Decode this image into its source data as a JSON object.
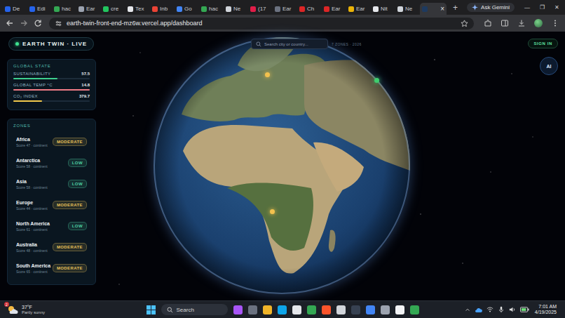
{
  "browser": {
    "tabs": [
      {
        "label": "De",
        "selected": false,
        "color": "#2563eb"
      },
      {
        "label": "Edi",
        "selected": false,
        "color": "#2563eb"
      },
      {
        "label": "hac",
        "selected": false,
        "color": "#34a853"
      },
      {
        "label": "Ear",
        "selected": false,
        "color": "#9ca3af"
      },
      {
        "label": "cre",
        "selected": false,
        "color": "#22c55e"
      },
      {
        "label": "Tex",
        "selected": false,
        "color": "#e5e7eb"
      },
      {
        "label": "Inb",
        "selected": false,
        "color": "#ea4335"
      },
      {
        "label": "Go",
        "selected": false,
        "color": "#4285f4"
      },
      {
        "label": "hac",
        "selected": false,
        "color": "#34a853"
      },
      {
        "label": "Ne",
        "selected": false,
        "color": "#d1d5db"
      },
      {
        "label": "(17",
        "selected": false,
        "color": "#e11d48"
      },
      {
        "label": "Ear",
        "selected": false,
        "color": "#6b7280"
      },
      {
        "label": "Ch",
        "selected": false,
        "color": "#dc2626"
      },
      {
        "label": "Ear",
        "selected": false,
        "color": "#dc2626"
      },
      {
        "label": "Ear",
        "selected": false,
        "color": "#eab308"
      },
      {
        "label": "Nit",
        "selected": false,
        "color": "#e5e7eb"
      },
      {
        "label": "Ne",
        "selected": false,
        "color": "#d1d5db"
      },
      {
        "label": "",
        "selected": true,
        "color": "#1e3a5f"
      }
    ],
    "close": "×",
    "new_tab": "+",
    "ask_gemini": "Ask Gemini",
    "window_controls": [
      "—",
      "❐",
      "✕"
    ],
    "url": "earth-twin-front-end-mz6w.vercel.app/dashboard"
  },
  "app": {
    "brand": "EARTH TWIN · LIVE",
    "search": {
      "placeholder": "Search city or country..."
    },
    "zone_count": "7 ZONES · 2026",
    "sign_in": "SIGN IN",
    "ai": "AI",
    "global_state": {
      "title": "GLOBAL STATE",
      "metrics": [
        {
          "label": "SUSTAINABILITY",
          "value": "57.5",
          "level": 0.575,
          "color": "#3ecf8e"
        },
        {
          "label": "GLOBAL TEMP °C",
          "value": "14.8",
          "level": 1.0,
          "color": "#f07c86"
        },
        {
          "label": "CO₂ INDEX",
          "value": "379.7",
          "level": 0.38,
          "color": "#f2c94c"
        }
      ]
    },
    "zones": {
      "title": "ZONES",
      "items": [
        {
          "name": "Africa",
          "detail": "Score 47 · continent",
          "badge": "MODERATE",
          "color": "#e8c15a"
        },
        {
          "name": "Antarctica",
          "detail": "Score 58 · continent",
          "badge": "LOW",
          "color": "#4fd1a5"
        },
        {
          "name": "Asia",
          "detail": "Score 58 · continent",
          "badge": "LOW",
          "color": "#4fd1a5"
        },
        {
          "name": "Europe",
          "detail": "Score 44 · continent",
          "badge": "MODERATE",
          "color": "#e8c15a"
        },
        {
          "name": "North America",
          "detail": "Score 61 · continent",
          "badge": "LOW",
          "color": "#4fd1a5"
        },
        {
          "name": "Australia",
          "detail": "Score 48 · continent",
          "badge": "MODERATE",
          "color": "#e8c15a"
        },
        {
          "name": "South America",
          "detail": "Score 65 · continent",
          "badge": "MODERATE",
          "color": "#e8c15a"
        }
      ]
    },
    "markers": [
      {
        "color": "#f2c14e"
      },
      {
        "color": "#f2c14e"
      },
      {
        "color": "#3ecf6e"
      }
    ]
  },
  "taskbar": {
    "weather": {
      "temp": "37°F",
      "condition": "Partly sunny",
      "badge": "2"
    },
    "search": "Search",
    "apps": [
      {
        "color": "#a855f7"
      },
      {
        "color": "#6b7280"
      },
      {
        "color": "#f0b429"
      },
      {
        "color": "#0ea5e9"
      },
      {
        "color": "#e5e7eb"
      },
      {
        "color": "#34a853"
      },
      {
        "color": "#fb542b"
      },
      {
        "color": "#d1d5db"
      },
      {
        "color": "#374151"
      },
      {
        "color": "#4285f4"
      },
      {
        "color": "#9ca3af"
      },
      {
        "color": "#f3f4f6"
      },
      {
        "color": "#34a853"
      }
    ],
    "time": "7:01 AM",
    "date": "4/19/2025"
  }
}
